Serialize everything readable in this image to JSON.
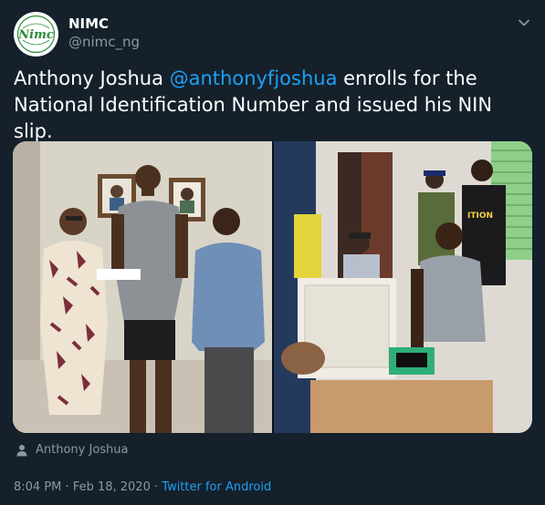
{
  "account": {
    "name": "NIMC",
    "handle": "@nimc_ng",
    "avatar_text": "Nimc"
  },
  "tweet": {
    "text_before": "Anthony Joshua ",
    "mention": "@anthonyfjoshua",
    "text_after": " enrolls for the National Identification Number and issued his NIN slip."
  },
  "tagged": {
    "name": "Anthony Joshua"
  },
  "meta": {
    "time": "8:04 PM",
    "separator": "·",
    "date": "Feb 18, 2020",
    "source": "Twitter for Android"
  },
  "colors": {
    "background": "#15202b",
    "accent": "#1da1f2",
    "secondary_text": "#8899a6",
    "brand_green": "#2e8b3a"
  },
  "icons": {
    "menu": "chevron-down-icon",
    "tag": "person-icon"
  }
}
